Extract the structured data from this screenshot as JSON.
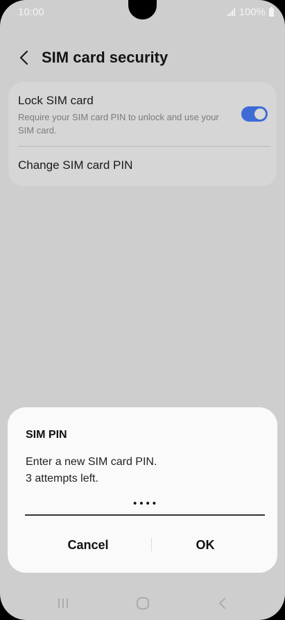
{
  "status_bar": {
    "time": "10:00",
    "battery": "100%",
    "signal_icon": "signal-icon",
    "battery_icon": "battery-icon"
  },
  "header": {
    "title": "SIM card security",
    "back_icon": "chevron-left-icon"
  },
  "settings": {
    "lock_sim": {
      "title": "Lock SIM card",
      "description": "Require your SIM card PIN to unlock and use your SIM card.",
      "enabled": true
    },
    "change_pin": {
      "title": "Change SIM card PIN"
    }
  },
  "dialog": {
    "title": "SIM PIN",
    "message_line1": "Enter a new SIM card PIN.",
    "message_line2": "3 attempts left.",
    "pin_value": "••••",
    "cancel_label": "Cancel",
    "ok_label": "OK"
  },
  "nav_bar": {
    "recent_icon": "recent-apps-icon",
    "home_icon": "home-icon",
    "back_icon": "back-icon"
  },
  "colors": {
    "accent": "#3e6bd6",
    "background": "#cecece",
    "card": "#d6d6d6",
    "dialog": "#fafafa"
  }
}
